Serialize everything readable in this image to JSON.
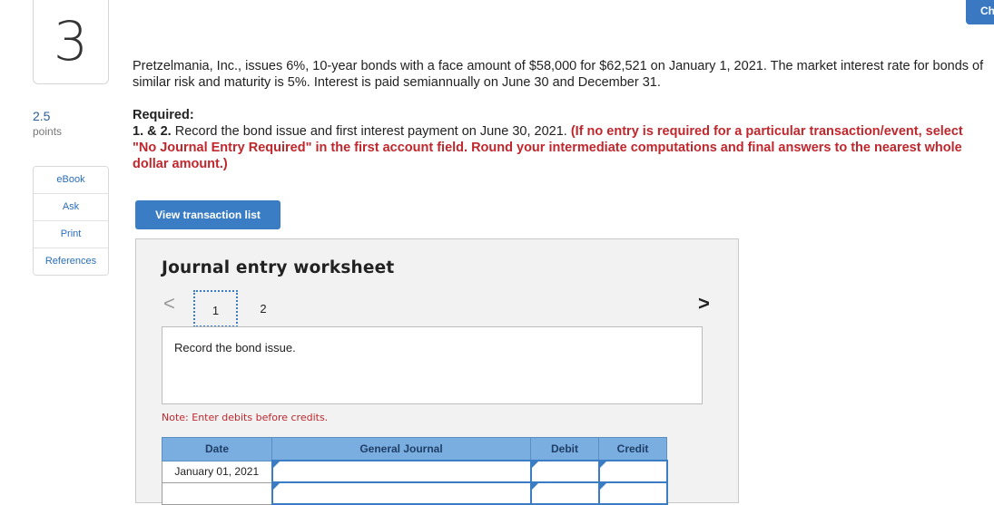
{
  "question": {
    "number": "3",
    "points_value": "2.5",
    "points_label": "points"
  },
  "side_menu": [
    {
      "label": "eBook"
    },
    {
      "label": "Ask"
    },
    {
      "label": "Print"
    },
    {
      "label": "References"
    }
  ],
  "check_tab": {
    "label": "Ch"
  },
  "problem": {
    "text": "Pretzelmania, Inc., issues 6%, 10-year bonds with a face amount of $58,000 for $62,521 on January 1, 2021. The market interest rate for bonds of similar risk and maturity is 5%. Interest is paid semiannually on June 30 and December 31."
  },
  "required": {
    "heading": "Required:",
    "number": "1. & 2.",
    "instruction": "Record the bond issue and first interest payment on June 30, 2021.",
    "red_note": "(If no entry is required for a particular transaction/event, select \"No Journal Entry Required\" in the first account field. Round your intermediate computations and final answers to the nearest whole dollar amount.)"
  },
  "view_transaction_button": {
    "label": "View transaction list"
  },
  "worksheet": {
    "title": "Journal entry worksheet",
    "pages": [
      "1",
      "2"
    ],
    "prev_symbol": "<",
    "next_symbol": ">",
    "task_text": "Record the bond issue.",
    "note": "Note: Enter debits before credits.",
    "columns": [
      "Date",
      "General Journal",
      "Debit",
      "Credit"
    ],
    "rows": [
      {
        "date": "January 01, 2021",
        "account": "",
        "debit": "",
        "credit": ""
      },
      {
        "date": "",
        "account": "",
        "debit": "",
        "credit": ""
      }
    ]
  },
  "colors": {
    "accent": "#3b7dc4",
    "header_blue": "#7aaee0",
    "note_red": "#c0272d"
  }
}
